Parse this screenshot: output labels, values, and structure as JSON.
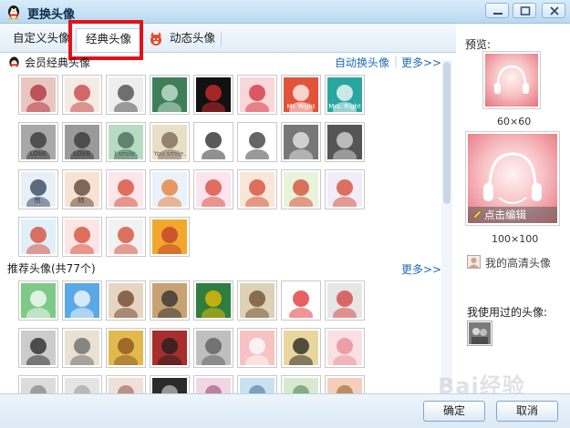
{
  "window": {
    "title": "更换头像"
  },
  "tabs": [
    {
      "label": "自定义头像"
    },
    {
      "label": "经典头像"
    },
    {
      "label": "动态头像"
    }
  ],
  "classic": {
    "heading": "会员经典头像",
    "auto_change_link": "自动换头像",
    "more_link": "更多>>"
  },
  "recommended": {
    "heading": "推荐头像(共77个)",
    "more_link": "更多>>"
  },
  "preview": {
    "label": "预览:",
    "small_size": "60×60",
    "big_size": "100×100",
    "edit_label": "点击编辑",
    "hd_link": "我的高清头像",
    "used_label": "我使用过的头像:"
  },
  "buttons": {
    "ok": "确定",
    "cancel": "取消"
  },
  "watermark": "Bai经验",
  "member_avatars": [
    {
      "name": "lips",
      "bg": "#e9c7c0",
      "fg": "#b02a3a",
      "text": ""
    },
    {
      "name": "girl-bow",
      "bg": "#f5eae4",
      "fg": "#c43c3c",
      "text": ""
    },
    {
      "name": "girl-hands",
      "bg": "#eeeeee",
      "fg": "#444444",
      "text": ""
    },
    {
      "name": "girl-green-hair",
      "bg": "#3e7f5a",
      "fg": "#cfe8d9",
      "text": ""
    },
    {
      "name": "red-lips-face",
      "bg": "#111111",
      "fg": "#d72b2b",
      "text": ""
    },
    {
      "name": "red-lips",
      "bg": "#f7d7d9",
      "fg": "#d52b3b",
      "text": ""
    },
    {
      "name": "egg-mr-right",
      "bg": "#e2533a",
      "fg": "#ffffff",
      "text": "Mr. Right"
    },
    {
      "name": "egg-mrs-right",
      "bg": "#2aa6a0",
      "fg": "#ffffff",
      "text": "Mrs. Right"
    },
    {
      "name": "love-shadow",
      "bg": "#a8a8a8",
      "fg": "#333333",
      "text": "LOVE"
    },
    {
      "name": "love-shadow-2",
      "bg": "#9a9a9a",
      "fg": "#333333",
      "text": "LOVE"
    },
    {
      "name": "i-smile",
      "bg": "#b7dcc3",
      "fg": "#446655",
      "text": "I smile."
    },
    {
      "name": "you-smile",
      "bg": "#e8dfc7",
      "fg": "#776655",
      "text": "You smile."
    },
    {
      "name": "cartoon-girl",
      "bg": "#ffffff",
      "fg": "#222222",
      "text": ""
    },
    {
      "name": "cartoon-girl-2",
      "bg": "#ffffff",
      "fg": "#333333",
      "text": ""
    },
    {
      "name": "couple-bw",
      "bg": "#777777",
      "fg": "#eeeeee",
      "text": ""
    },
    {
      "name": "hand-bw",
      "bg": "#555555",
      "fg": "#dddddd",
      "text": ""
    },
    {
      "name": "ta-he",
      "bg": "#e8f0f7",
      "fg": "#2f3b5a",
      "text": "他."
    },
    {
      "name": "ta-she",
      "bg": "#f7e3d3",
      "fg": "#5a3b2f",
      "text": "她."
    },
    {
      "name": "fox-1",
      "bg": "#fbe6ea",
      "fg": "#d6452f",
      "text": ""
    },
    {
      "name": "fox-2",
      "bg": "#e9f1fb",
      "fg": "#e47a2f",
      "text": ""
    },
    {
      "name": "fox-3",
      "bg": "#fde3ef",
      "fg": "#d6452f",
      "text": ""
    },
    {
      "name": "fox-4",
      "bg": "#f8e7d8",
      "fg": "#d6452f",
      "text": ""
    },
    {
      "name": "fox-5",
      "bg": "#e7f3da",
      "fg": "#d6452f",
      "text": ""
    },
    {
      "name": "fox-6",
      "bg": "#f2ecf9",
      "fg": "#d6452f",
      "text": ""
    },
    {
      "name": "fox-7",
      "bg": "#dff0fb",
      "fg": "#d6452f",
      "text": ""
    },
    {
      "name": "fox-8",
      "bg": "#fbe5e5",
      "fg": "#d6452f",
      "text": ""
    },
    {
      "name": "fox-9",
      "bg": "#f2f2f2",
      "fg": "#d6452f",
      "text": ""
    },
    {
      "name": "fox-10",
      "bg": "#f2a82d",
      "fg": "#c0392b",
      "text": ""
    }
  ],
  "recommended_avatars": [
    {
      "name": "green-head",
      "bg": "#7fc987",
      "fg": "#ffffff",
      "text": ""
    },
    {
      "name": "blue-smile",
      "bg": "#5aa9e6",
      "fg": "#ffffff",
      "text": ""
    },
    {
      "name": "coffee-cup",
      "bg": "#e7d5c3",
      "fg": "#6b3e26",
      "text": ""
    },
    {
      "name": "opera-mask",
      "bg": "#c9a274",
      "fg": "#2b2b2b",
      "text": ""
    },
    {
      "name": "penguin",
      "bg": "#2f7d3f",
      "fg": "#f2c200",
      "text": ""
    },
    {
      "name": "coffee-swirl",
      "bg": "#ddd1b8",
      "fg": "#6a4b2a",
      "text": ""
    },
    {
      "name": "red-robot",
      "bg": "#ffffff",
      "fg": "#e22b2b",
      "text": ""
    },
    {
      "name": "pencils",
      "bg": "#e6e6e6",
      "fg": "#d33d3d",
      "text": ""
    },
    {
      "name": "feather-bw",
      "bg": "#cccccc",
      "fg": "#222222",
      "text": ""
    },
    {
      "name": "notes",
      "bg": "#e9e1d1",
      "fg": "#666666",
      "text": ""
    },
    {
      "name": "cake",
      "bg": "#e2b94e",
      "fg": "#8a4f1c",
      "text": ""
    },
    {
      "name": "opera-face",
      "bg": "#a82d2d",
      "fg": "#1d1d1d",
      "text": ""
    },
    {
      "name": "hummingbird",
      "bg": "#bfbfbf",
      "fg": "#5a5a5a",
      "text": ""
    },
    {
      "name": "pink-head",
      "bg": "#f6c2c3",
      "fg": "#ffffff",
      "text": ""
    },
    {
      "name": "penguins",
      "bg": "#e9d69f",
      "fg": "#1d1d1d",
      "text": ""
    },
    {
      "name": "pink-frame",
      "bg": "#fbe0e3",
      "fg": "#e78a95",
      "text": ""
    },
    {
      "name": "row3-1",
      "bg": "#dcdcdc",
      "fg": "#888888",
      "text": ""
    },
    {
      "name": "row3-2",
      "bg": "#e5e5e5",
      "fg": "#aaaaaa",
      "text": ""
    },
    {
      "name": "row3-3",
      "bg": "#f0e0d8",
      "fg": "#aa7766",
      "text": ""
    },
    {
      "name": "row3-4",
      "bg": "#2b2b2b",
      "fg": "#bbbbbb",
      "text": ""
    },
    {
      "name": "row3-5",
      "bg": "#f2d6e4",
      "fg": "#aa6688",
      "text": ""
    },
    {
      "name": "row3-6",
      "bg": "#c9e1f0",
      "fg": "#6688aa",
      "text": ""
    },
    {
      "name": "row3-7",
      "bg": "#d8e9d2",
      "fg": "#669966",
      "text": ""
    },
    {
      "name": "row3-8",
      "bg": "#f5cfb9",
      "fg": "#aa7744",
      "text": ""
    }
  ]
}
